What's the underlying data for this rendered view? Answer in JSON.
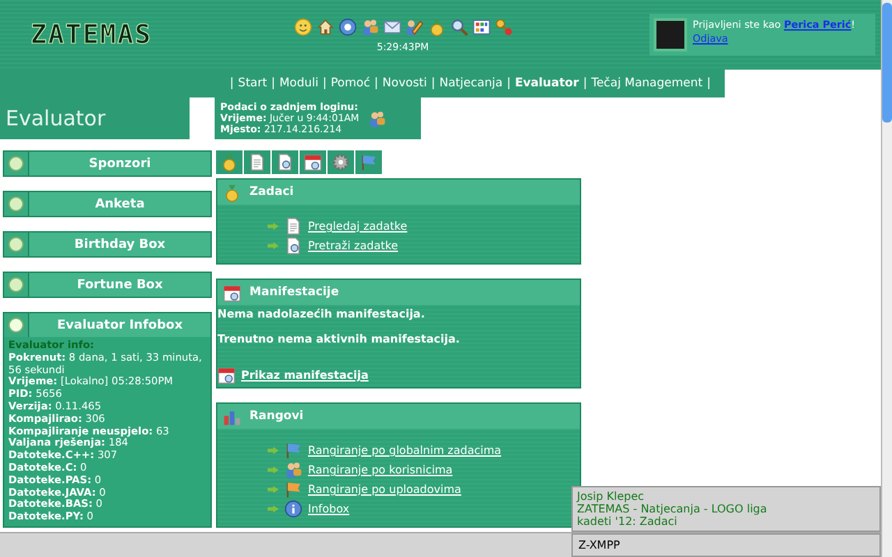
{
  "header": {
    "logo": "ZATEMAS",
    "clock": "5:29:43PM",
    "login": {
      "prefix": "Prijavljeni ste kao",
      "user": "Perica Perić",
      "suffix": "!",
      "logout": "Odjava"
    }
  },
  "nav_separator": "|",
  "nav": [
    {
      "label": "Start",
      "selected": false
    },
    {
      "label": "Moduli",
      "selected": false
    },
    {
      "label": "Pomoć",
      "selected": false
    },
    {
      "label": "Novosti",
      "selected": false
    },
    {
      "label": "Natjecanja",
      "selected": false
    },
    {
      "label": "Evaluator",
      "selected": true
    },
    {
      "label": "Tečaj Management",
      "selected": false
    }
  ],
  "page_title": "Evaluator",
  "last_login": {
    "heading": "Podaci o zadnjem loginu:",
    "lines": [
      {
        "label": "Vrijeme:",
        "value": "Jučer u 9:44:01AM"
      },
      {
        "label": "Mjesto:",
        "value": "217.14.216.214"
      }
    ]
  },
  "sidebar": [
    {
      "title": "Sponzori",
      "expanded": false
    },
    {
      "title": "Anketa",
      "expanded": false
    },
    {
      "title": "Birthday Box",
      "expanded": false
    },
    {
      "title": "Fortune Box",
      "expanded": false
    },
    {
      "title": "Evaluator Infobox",
      "expanded": true,
      "heading": "Evaluator info:",
      "lines": [
        {
          "label": "Pokrenut:",
          "value": "8  dana, 1  sati, 33  minuta, 56  sekundi"
        },
        {
          "label": "Vrijeme:",
          "value": "[Lokalno]  05:28:50PM"
        },
        {
          "label": "PID:",
          "value": "5656"
        },
        {
          "label": "Verzija:",
          "value": "0.11.465"
        },
        {
          "label": "Kompajlirao:",
          "value": "306"
        },
        {
          "label": "Kompajliranje neuspjelo:",
          "value": "63"
        },
        {
          "label": "Valjana rješenja:",
          "value": "184"
        },
        {
          "label": "Datoteke.C++:",
          "value": "307"
        },
        {
          "label": "Datoteke.C:",
          "value": "0"
        },
        {
          "label": "Datoteke.PAS:",
          "value": "0"
        },
        {
          "label": "Datoteke.JAVA:",
          "value": "0"
        },
        {
          "label": "Datoteke.BAS:",
          "value": "0"
        },
        {
          "label": "Datoteke.PY:",
          "value": "0"
        }
      ]
    }
  ],
  "panels": [
    {
      "kind": "links",
      "title": "Zadaci",
      "links": [
        {
          "label": "Pregledaj zadatke"
        },
        {
          "label": "Pretraži zadatke"
        }
      ]
    },
    {
      "kind": "text",
      "title": "Manifestacije",
      "paragraphs": [
        "Nema nadolazećih manifestacija.",
        "Trenutno nema aktivnih manifestacija."
      ],
      "link": "Prikaz manifestacija"
    },
    {
      "kind": "links",
      "title": "Rangovi",
      "links": [
        {
          "label": "Rangiranje po globalnim zadacima"
        },
        {
          "label": "Rangiranje po korisnicima"
        },
        {
          "label": "Rangiranje po uploadovima"
        },
        {
          "label": "Infobox"
        }
      ]
    }
  ],
  "chat": {
    "lines": [
      "Josip Klepec",
      "ZATEMAS - Natjecanja - LOGO liga",
      "kadeti '12: Zadaci"
    ],
    "title": "Z-XMPP"
  }
}
